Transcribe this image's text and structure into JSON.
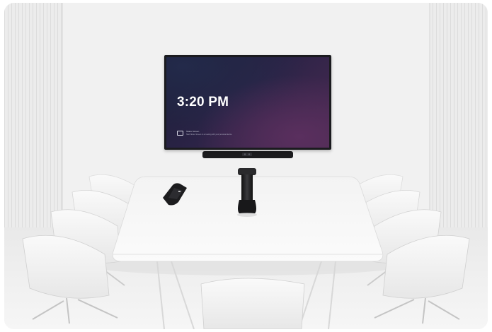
{
  "screen": {
    "clock": "3:20 PM",
    "hint_title": "Share Screen",
    "hint_subtitle": "Start Share Screen in a meeting with your personal device"
  },
  "colors": {
    "wall": "#f1f1f1",
    "furniture": "#f7f7f7",
    "device": "#1c1c1e"
  },
  "icons": [
    "share-screen-icon"
  ]
}
